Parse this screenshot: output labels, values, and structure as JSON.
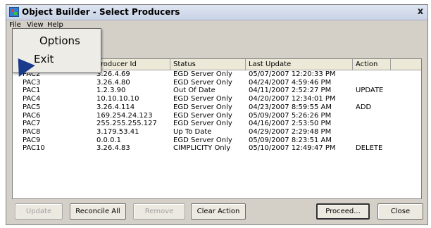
{
  "window": {
    "title": "Object Builder - Select Producers",
    "close_glyph": "x"
  },
  "menubar": {
    "file": "File",
    "view": "View",
    "help": "Help"
  },
  "file_menu": {
    "options": "Options",
    "exit": "Exit"
  },
  "stub_text": "P",
  "table": {
    "columns": [
      "",
      "Producer Id",
      "Status",
      "Last Update",
      "Action",
      ""
    ],
    "rows": [
      {
        "name": "PAC2",
        "id": "3.26.4.69",
        "status": "EGD Server Only",
        "updated": "05/07/2007 12:20:33 PM",
        "action": ""
      },
      {
        "name": "PAC3",
        "id": "3.26.4.80",
        "status": "EGD Server Only",
        "updated": "04/24/2007 4:59:46 PM",
        "action": ""
      },
      {
        "name": "PAC1",
        "id": "1.2.3.90",
        "status": "Out Of Date",
        "updated": "04/11/2007 2:52:27 PM",
        "action": "UPDATE"
      },
      {
        "name": "PAC4",
        "id": "10.10.10.10",
        "status": "EGD Server Only",
        "updated": "04/20/2007 12:34:01 PM",
        "action": ""
      },
      {
        "name": "PAC5",
        "id": "3.26.4.114",
        "status": "EGD Server Only",
        "updated": "04/23/2007 8:59:55 AM",
        "action": "ADD"
      },
      {
        "name": "PAC6",
        "id": "169.254.24.123",
        "status": "EGD Server Only",
        "updated": "05/09/2007 5:26:26 PM",
        "action": ""
      },
      {
        "name": "PAC7",
        "id": "255.255.255.127",
        "status": "EGD Server Only",
        "updated": "04/16/2007 2:53:50 PM",
        "action": ""
      },
      {
        "name": "PAC8",
        "id": "3.179.53.41",
        "status": "Up To Date",
        "updated": "04/29/2007 2:29:48 PM",
        "action": ""
      },
      {
        "name": "PAC9",
        "id": "0.0.0.1",
        "status": "EGD Server Only",
        "updated": "05/09/2007 8:23:51 AM",
        "action": ""
      },
      {
        "name": "PAC10",
        "id": "3.26.4.83",
        "status": "CIMPLICITY Only",
        "updated": "05/10/2007 12:49:47 PM",
        "action": "DELETE"
      }
    ]
  },
  "buttons": {
    "update": "Update",
    "reconcile_all": "Reconcile All",
    "remove": "Remove",
    "clear_action": "Clear Action",
    "proceed": "Proceed...",
    "close": "Close"
  }
}
